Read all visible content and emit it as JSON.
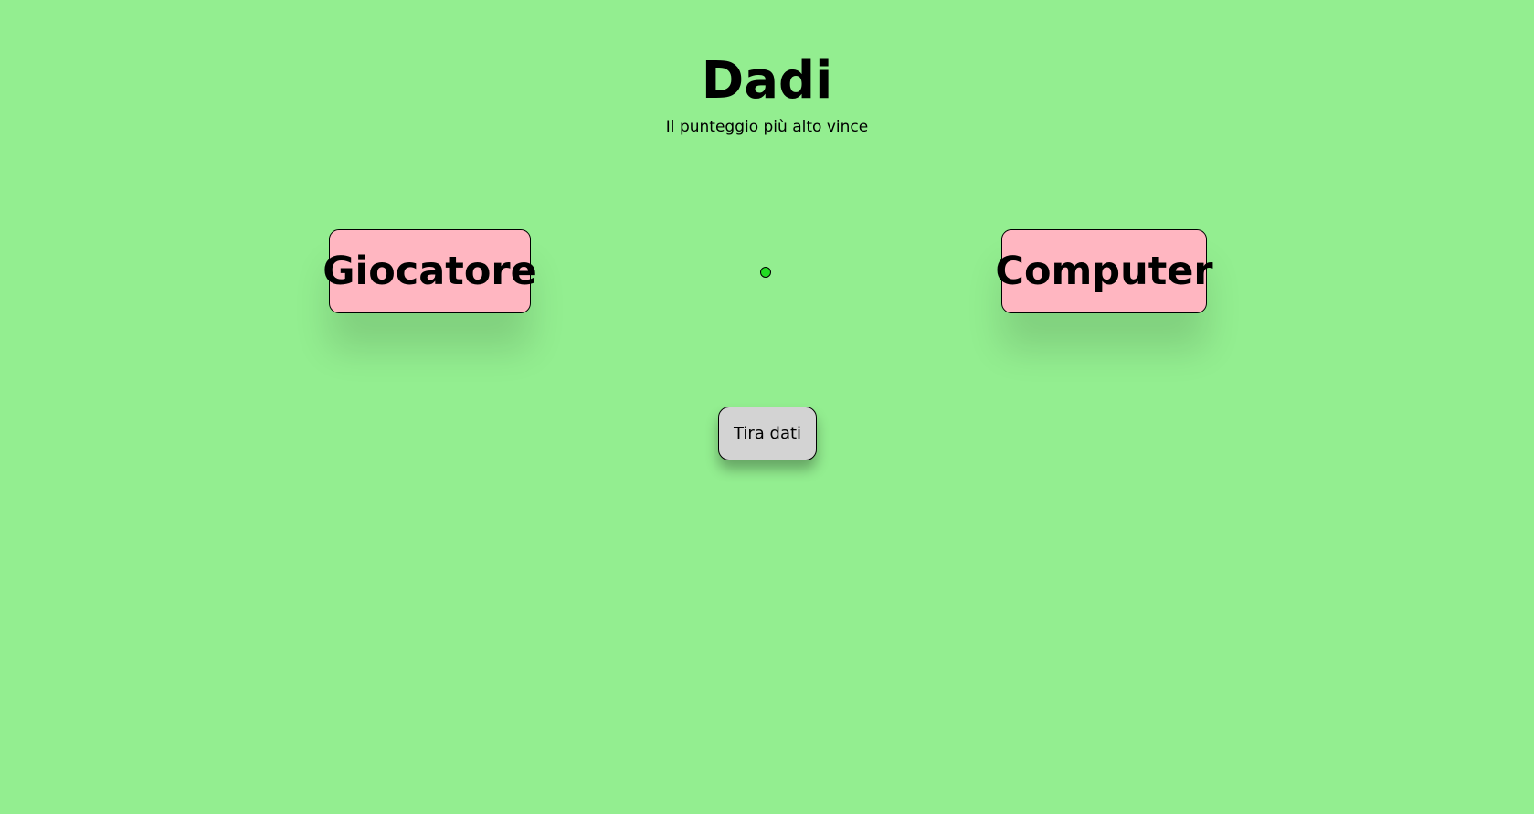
{
  "header": {
    "title": "Dadi",
    "subtitle": "Il punteggio più alto vince"
  },
  "players": {
    "left_label": "Giocatore",
    "right_label": "Computer"
  },
  "status": {
    "indicator_color": "#22dd22"
  },
  "controls": {
    "roll_label": "Tira dati"
  },
  "colors": {
    "background": "#93ee90",
    "player_box": "#ffb6c1",
    "button": "#d3d3d3"
  }
}
